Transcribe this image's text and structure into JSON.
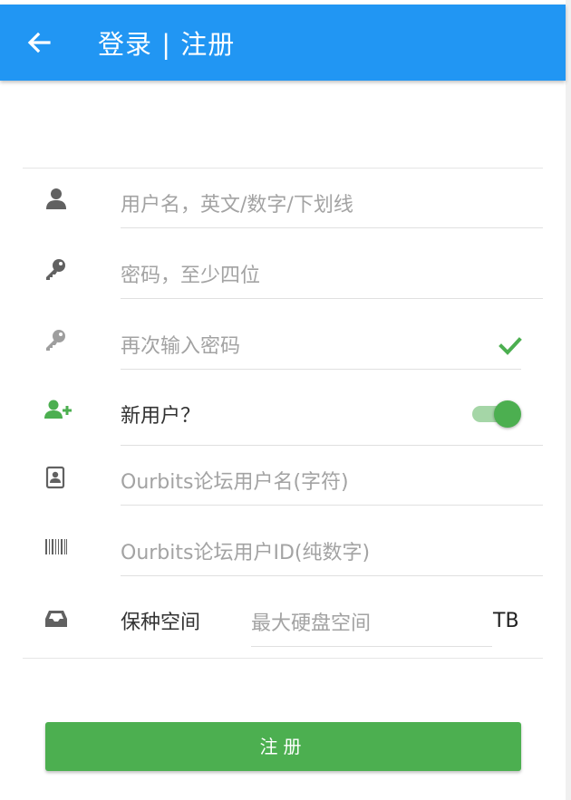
{
  "appbar": {
    "title": "登录 | 注册",
    "back_icon": "arrow-left-icon",
    "color": "#2196f3"
  },
  "form": {
    "username": {
      "icon": "user-icon",
      "placeholder": "用户名，英文/数字/下划线",
      "value": ""
    },
    "password": {
      "icon": "key-icon",
      "placeholder": "密码，至少四位",
      "value": ""
    },
    "confirm_password": {
      "icon": "key-icon",
      "placeholder": "再次输入密码",
      "value": "",
      "status_icon": "check-icon"
    },
    "new_user": {
      "icon": "user-plus-icon",
      "label": "新用户？",
      "toggle_on": true
    },
    "forum_username": {
      "icon": "id-card-icon",
      "placeholder": "Ourbits论坛用户名(字符)",
      "value": ""
    },
    "forum_user_id": {
      "icon": "barcode-icon",
      "placeholder": "Ourbits论坛用户ID(纯数字)",
      "value": ""
    },
    "seed_space": {
      "icon": "inbox-icon",
      "label": "保种空间",
      "placeholder": "最大硬盘空间",
      "value": "",
      "unit": "TB"
    }
  },
  "submit": {
    "label": "注册",
    "color": "#4caf50"
  }
}
